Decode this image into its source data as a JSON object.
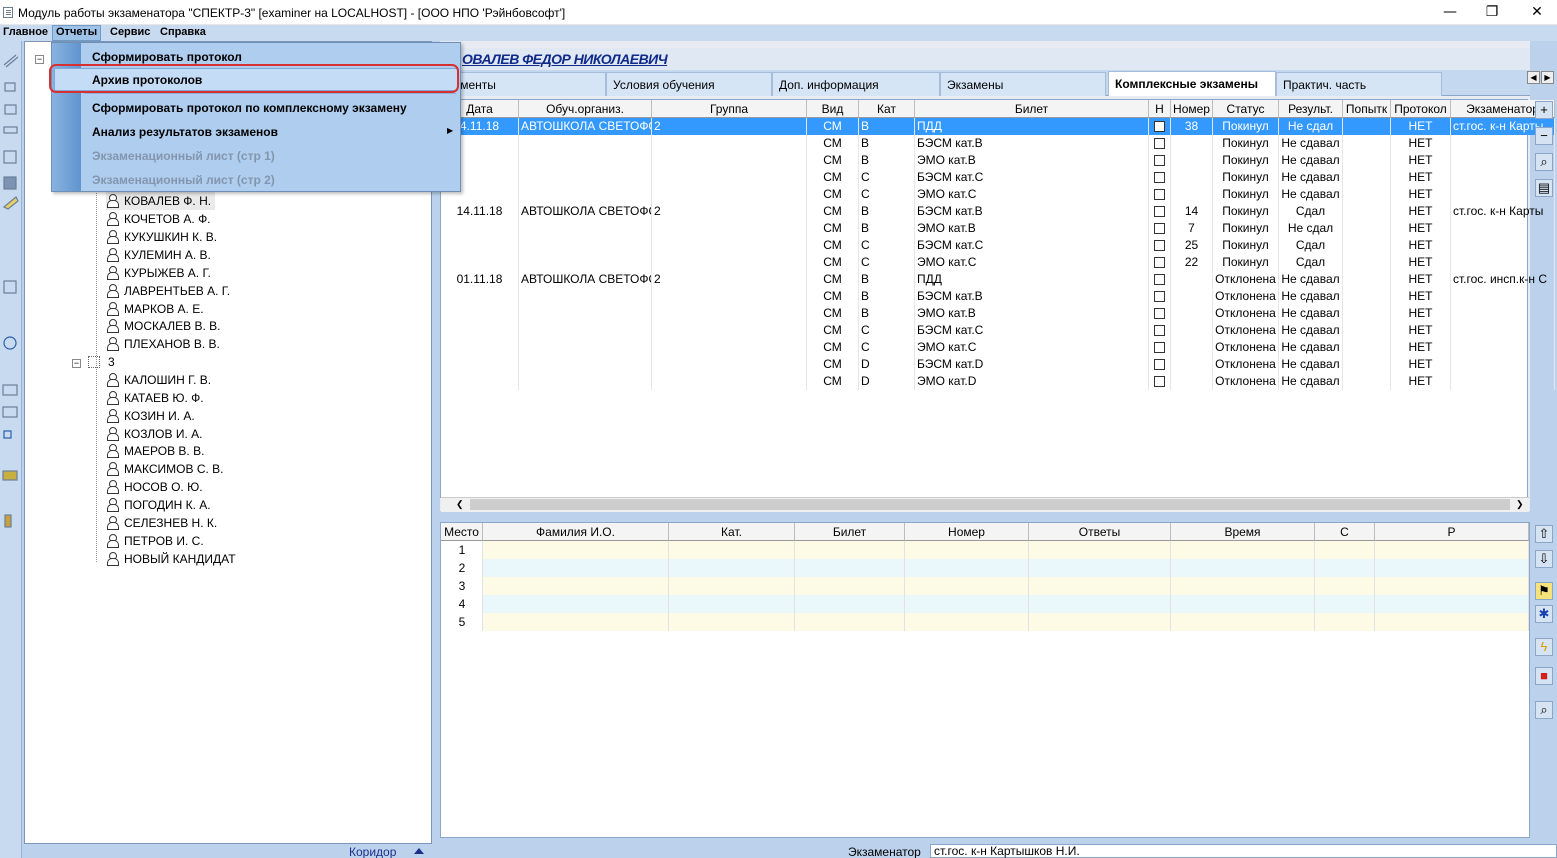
{
  "window": {
    "title": "Модуль работы экзаменатора \"СПЕКТР-3\" [examiner на LOCALHOST] - [ООО НПО 'Рэйнбовсофт']",
    "controls": {
      "minimize": "—",
      "restore": "❐",
      "close": "✕"
    }
  },
  "menubar": {
    "items": [
      "Главное",
      "Отчеты",
      "Сервис",
      "Справка"
    ]
  },
  "dropdown": {
    "items": [
      {
        "label": "Сформировать протокол",
        "enabled": true
      },
      {
        "label": "Архив протоколов",
        "enabled": true
      },
      {
        "label": "Сформировать протокол по комплексному экзамену",
        "enabled": true
      },
      {
        "label": "Анализ результатов экзаменов",
        "enabled": true
      },
      {
        "label": "Экзаменационный лист (стр 1)",
        "enabled": false
      },
      {
        "label": "Экзаменационный лист (стр 2)",
        "enabled": false
      }
    ]
  },
  "tree": {
    "group_a": [
      "КОВАЛЕВ Ф. Н.",
      "КОЧЕТОВ А. Ф.",
      "КУКУШКИН К. В.",
      "КУЛЕМИН А. В.",
      "КУРЫЖЕВ А. Г.",
      "ЛАВРЕНТЬЕВ А. Г.",
      "МАРКОВ А. Е.",
      "МОСКАЛЕВ В. В.",
      "ПЛЕХАНОВ В. В."
    ],
    "group_b_label": "3",
    "group_b": [
      "КАЛОШИН Г. В.",
      "КАТАЕВ Ю. Ф.",
      "КОЗИН И. А.",
      "КОЗЛОВ И. А.",
      "МАЕРОВ В. В.",
      "МАКСИМОВ С. В.",
      "НОСОВ О. Ю.",
      "ПОГОДИН К. А.",
      "СЕЛЕЗНЕВ Н. К.",
      "ПЕТРОВ И. С.",
      "НОВЫЙ КАНДИДАТ"
    ]
  },
  "candidate_name": "ОВАЛЕВ ФЕДОР НИКОЛАЕВИЧ",
  "tabs": [
    "кументы",
    "Условия обучения",
    "Доп. информация",
    "Экзамены",
    "Комплексные экзамены",
    "Практич. часть"
  ],
  "active_tab": "Комплексные экзамены",
  "grid": {
    "columns": [
      "Дата",
      "Обуч.организ.",
      "Группа",
      "Вид",
      "Кат",
      "Билет",
      "Н",
      "Номер",
      "Статус",
      "Результ.",
      "Попытк",
      "Протокол",
      "Экзаменатор"
    ],
    "rows": [
      [
        "4.11.18",
        "АВТОШКОЛА СВЕТОФО",
        "2",
        "СМ",
        "В",
        "ПДД",
        "",
        "38",
        "Покинул",
        "Не сдал",
        "",
        "НЕТ",
        "ст.гос. к-н Карты"
      ],
      [
        "",
        "",
        "",
        "СМ",
        "В",
        "БЭСМ кат.В",
        "",
        "",
        "Покинул",
        "Не сдавал",
        "",
        "НЕТ",
        ""
      ],
      [
        "",
        "",
        "",
        "СМ",
        "В",
        "ЭМО кат.В",
        "",
        "",
        "Покинул",
        "Не сдавал",
        "",
        "НЕТ",
        ""
      ],
      [
        "",
        "",
        "",
        "СМ",
        "С",
        "БЭСМ кат.С",
        "",
        "",
        "Покинул",
        "Не сдавал",
        "",
        "НЕТ",
        ""
      ],
      [
        "",
        "",
        "",
        "СМ",
        "С",
        "ЭМО кат.С",
        "",
        "",
        "Покинул",
        "Не сдавал",
        "",
        "НЕТ",
        ""
      ],
      [
        "14.11.18",
        "АВТОШКОЛА СВЕТОФО",
        "2",
        "СМ",
        "В",
        "БЭСМ кат.В",
        "",
        "14",
        "Покинул",
        "Сдал",
        "",
        "НЕТ",
        "ст.гос. к-н Карты"
      ],
      [
        "",
        "",
        "",
        "СМ",
        "В",
        "ЭМО кат.В",
        "",
        "7",
        "Покинул",
        "Не сдал",
        "",
        "НЕТ",
        ""
      ],
      [
        "",
        "",
        "",
        "СМ",
        "С",
        "БЭСМ кат.С",
        "",
        "25",
        "Покинул",
        "Сдал",
        "",
        "НЕТ",
        ""
      ],
      [
        "",
        "",
        "",
        "СМ",
        "С",
        "ЭМО кат.С",
        "",
        "22",
        "Покинул",
        "Сдал",
        "",
        "НЕТ",
        ""
      ],
      [
        "01.11.18",
        "АВТОШКОЛА СВЕТОФО",
        "2",
        "СМ",
        "В",
        "ПДД",
        "",
        "",
        "Отклонена",
        "Не сдавал",
        "",
        "НЕТ",
        "ст.гос. инсп.к-н С"
      ],
      [
        "",
        "",
        "",
        "СМ",
        "В",
        "БЭСМ кат.В",
        "",
        "",
        "Отклонена",
        "Не сдавал",
        "",
        "НЕТ",
        ""
      ],
      [
        "",
        "",
        "",
        "СМ",
        "В",
        "ЭМО кат.В",
        "",
        "",
        "Отклонена",
        "Не сдавал",
        "",
        "НЕТ",
        ""
      ],
      [
        "",
        "",
        "",
        "СМ",
        "С",
        "БЭСМ кат.С",
        "",
        "",
        "Отклонена",
        "Не сдавал",
        "",
        "НЕТ",
        ""
      ],
      [
        "",
        "",
        "",
        "СМ",
        "С",
        "ЭМО кат.С",
        "",
        "",
        "Отклонена",
        "Не сдавал",
        "",
        "НЕТ",
        ""
      ],
      [
        "",
        "",
        "",
        "СМ",
        "D",
        "БЭСМ кат.D",
        "",
        "",
        "Отклонена",
        "Не сдавал",
        "",
        "НЕТ",
        ""
      ],
      [
        "",
        "",
        "",
        "СМ",
        "D",
        "ЭМО кат.D",
        "",
        "",
        "Отклонена",
        "Не сдавал",
        "",
        "НЕТ",
        ""
      ]
    ]
  },
  "lower_grid": {
    "columns": [
      "Место",
      "Фамилия И.О.",
      "Кат.",
      "Билет",
      "Номер",
      "Ответы",
      "Время",
      "С",
      "Р"
    ],
    "places": [
      "1",
      "2",
      "3",
      "4",
      "5"
    ]
  },
  "status": {
    "corridor_label": "Коридор",
    "examiner_label": "Экзаменатор",
    "examiner_value": "ст.гос. к-н Картышков Н.И."
  },
  "colors": {
    "selection": "#3399ff",
    "highlight_oval": "#d83030",
    "row_yellow": "#fdfbe6",
    "row_cyan": "#eaf8fb"
  }
}
